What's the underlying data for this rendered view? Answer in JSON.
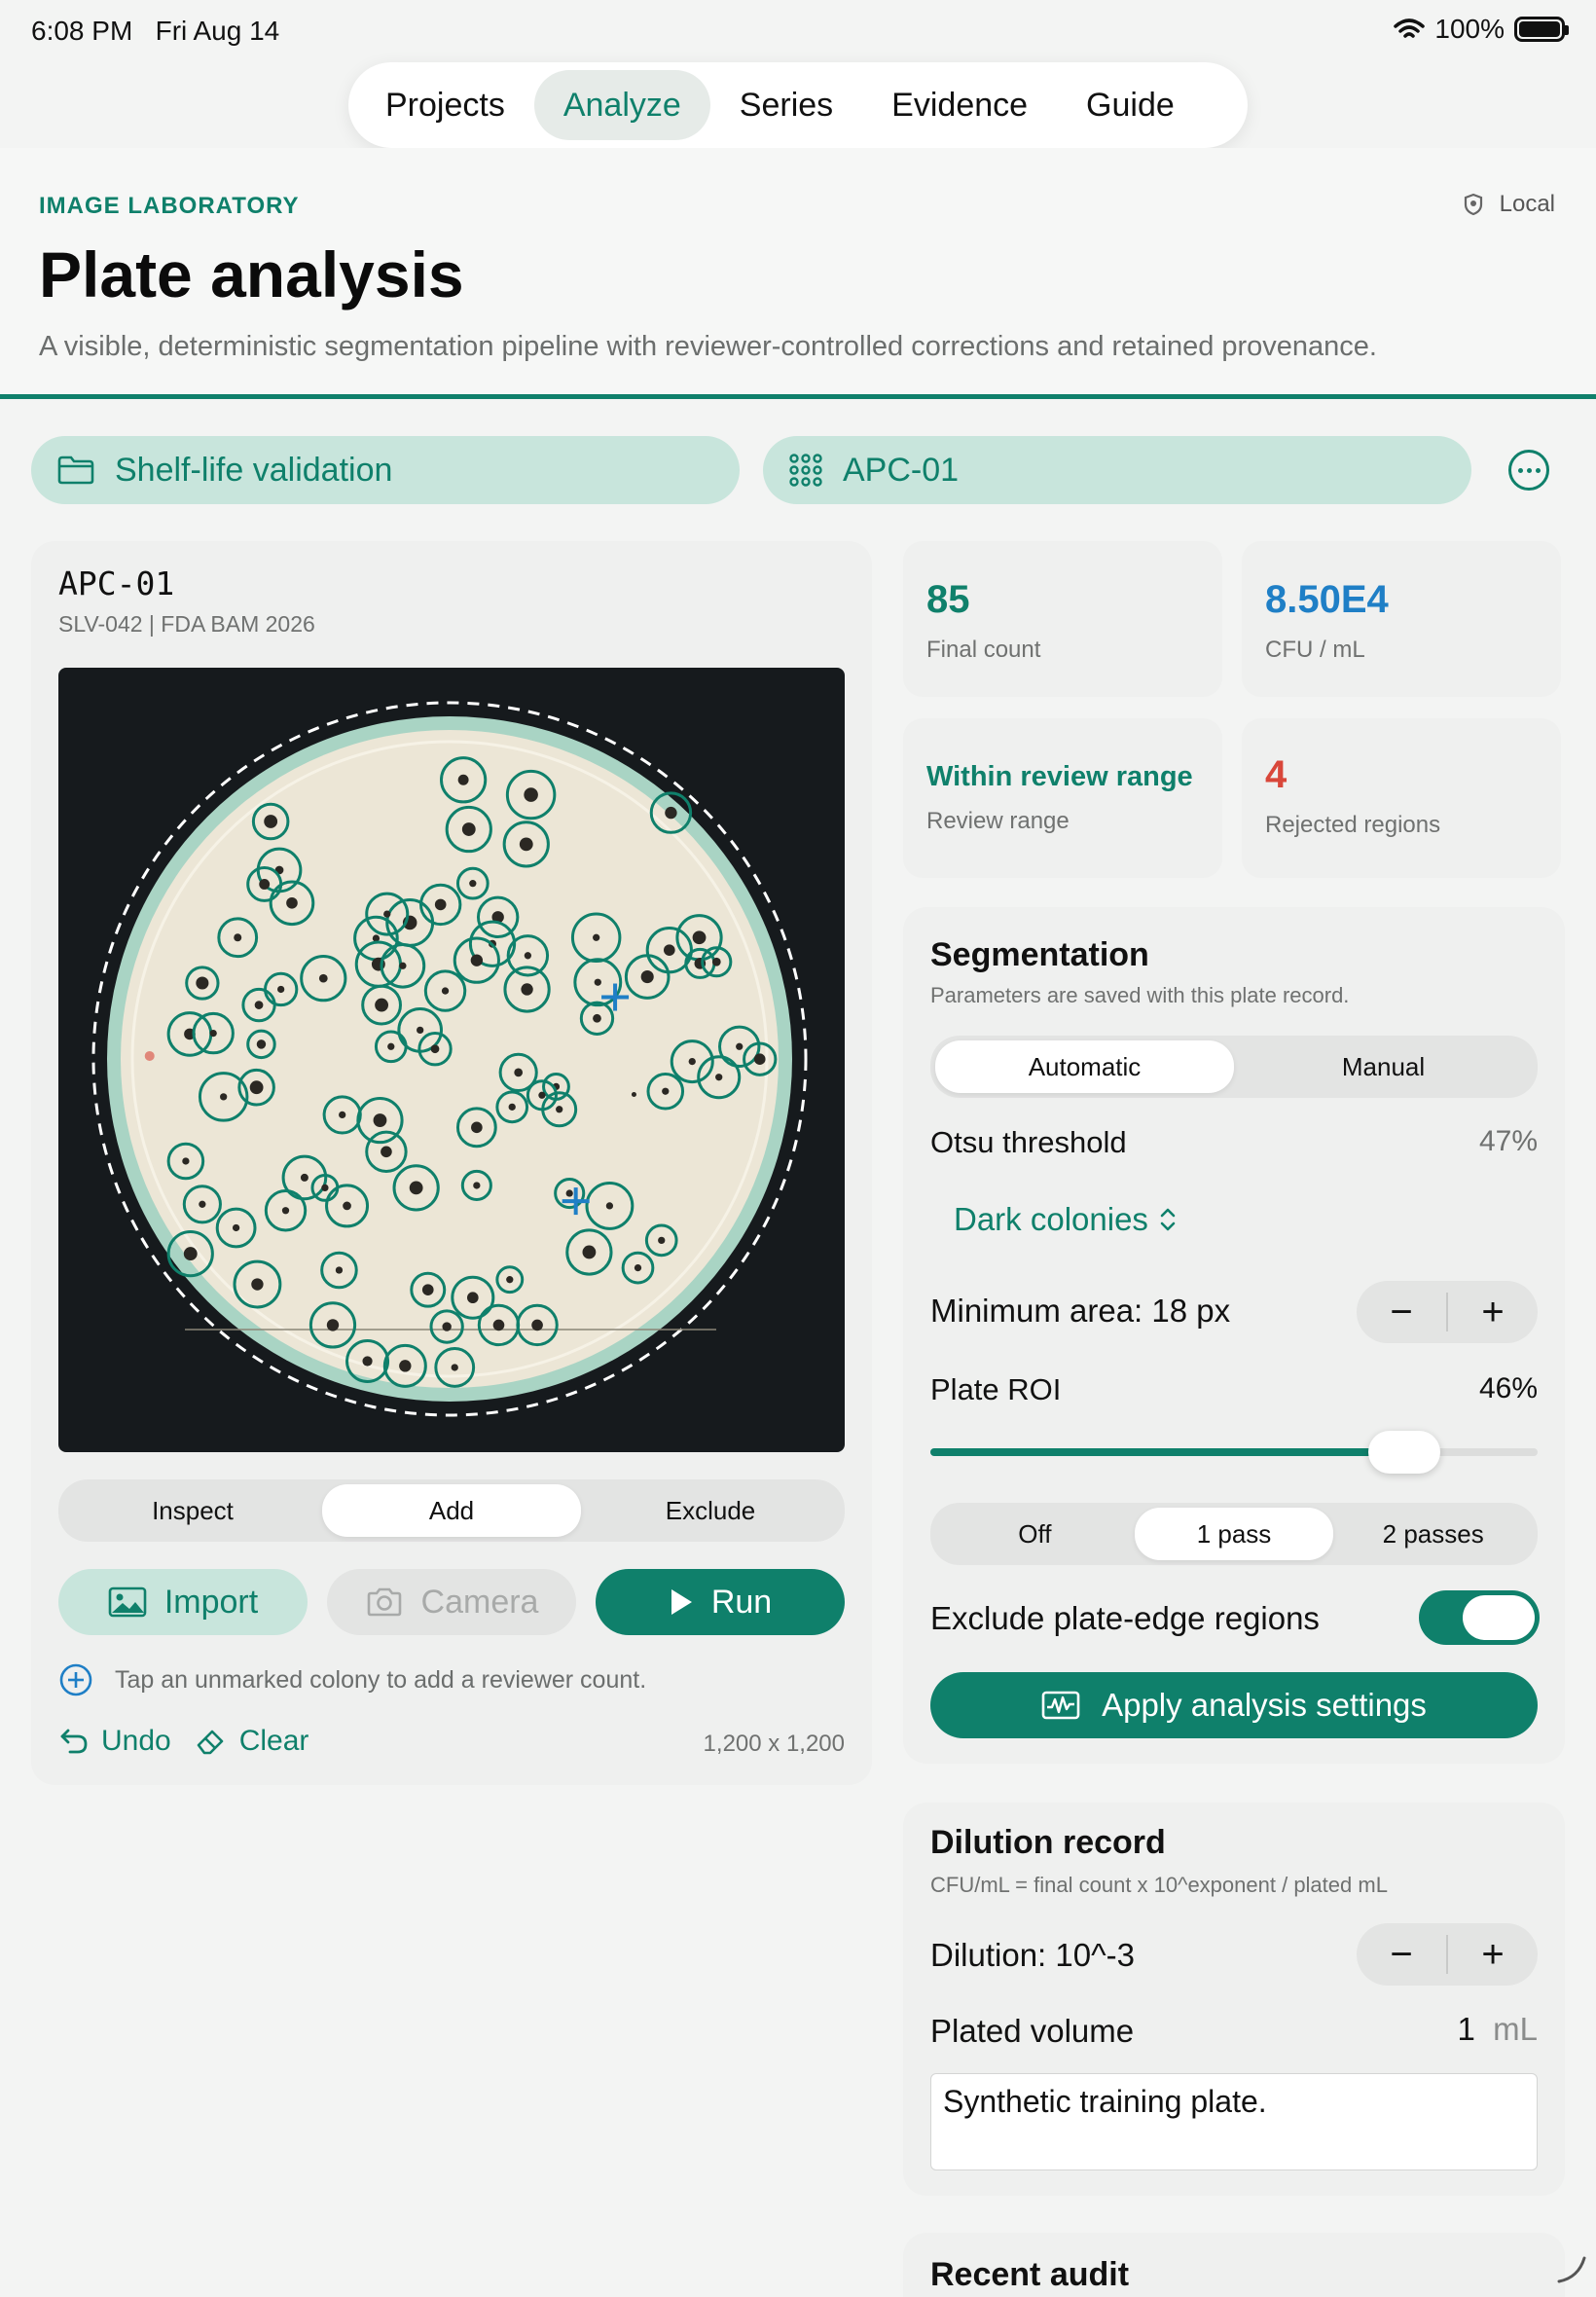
{
  "status": {
    "time": "6:08 PM",
    "date": "Fri Aug 14",
    "battery": "100%",
    "wifi_icon": "wifi-icon",
    "battery_icon": "battery-icon"
  },
  "topnav": {
    "tabs": [
      "Projects",
      "Analyze",
      "Series",
      "Evidence",
      "Guide"
    ],
    "active": "Analyze"
  },
  "header": {
    "eyebrow": "IMAGE LABORATORY",
    "badge": "Local",
    "title": "Plate analysis",
    "subtitle": "A visible, deterministic segmentation pipeline with reviewer-controlled corrections and retained provenance."
  },
  "selectors": {
    "project": "Shelf-life validation",
    "plate": "APC-01"
  },
  "plate": {
    "id": "APC-01",
    "meta": "SLV-042  |  FDA BAM 2026",
    "modes": [
      "Inspect",
      "Add",
      "Exclude"
    ],
    "active_mode": "Add",
    "import_label": "Import",
    "camera_label": "Camera",
    "run_label": "Run",
    "hint": "Tap an unmarked colony to add a reviewer count.",
    "undo_label": "Undo",
    "clear_label": "Clear",
    "dimensions": "1,200 x 1,200"
  },
  "metrics": {
    "final_count": "85",
    "final_count_label": "Final count",
    "cfu": "8.50E4",
    "cfu_label": "CFU / mL",
    "range_status": "Within review range",
    "range_label": "Review range",
    "rejected": "4",
    "rejected_label": "Rejected regions"
  },
  "segmentation": {
    "title": "Segmentation",
    "subtitle": "Parameters are saved with this plate record.",
    "modes": [
      "Automatic",
      "Manual"
    ],
    "active_mode": "Automatic",
    "otsu_label": "Otsu threshold",
    "otsu_value": "47%",
    "polarity": "Dark colonies",
    "min_area": "Minimum area: 18 px",
    "roi_label": "Plate ROI",
    "roi_value": "46%",
    "roi_fraction": 0.78,
    "passes": [
      "Off",
      "1 pass",
      "2 passes"
    ],
    "active_pass": "1 pass",
    "exclude_edge": "Exclude plate-edge regions",
    "exclude_edge_on": true,
    "apply": "Apply analysis settings"
  },
  "dilution": {
    "title": "Dilution record",
    "formula": "CFU/mL = final count x 10^exponent / plated mL",
    "dilution": "Dilution: 10^-3",
    "volume_label": "Plated volume",
    "volume_value": "1",
    "volume_unit": "mL",
    "notes": "Synthetic training plate."
  },
  "audit": {
    "title": "Recent audit"
  },
  "colors": {
    "accent": "#0f806b",
    "blue": "#1f7fc6",
    "red": "#d9473a",
    "agar": "#ece6d6"
  },
  "colonies": [
    [
      0.515,
      0.143,
      0.015,
      0.028
    ],
    [
      0.601,
      0.162,
      0.02,
      0.03
    ],
    [
      0.522,
      0.206,
      0.019,
      0.028
    ],
    [
      0.595,
      0.225,
      0.019,
      0.028
    ],
    [
      0.779,
      0.185,
      0.017,
      0.025
    ],
    [
      0.27,
      0.196,
      0.019,
      0.022
    ],
    [
      0.281,
      0.258,
      0.012,
      0.027
    ],
    [
      0.262,
      0.276,
      0.015,
      0.021
    ],
    [
      0.297,
      0.3,
      0.016,
      0.027
    ],
    [
      0.527,
      0.275,
      0.01,
      0.019
    ],
    [
      0.486,
      0.302,
      0.016,
      0.025
    ],
    [
      0.559,
      0.318,
      0.017,
      0.025
    ],
    [
      0.447,
      0.325,
      0.02,
      0.029
    ],
    [
      0.418,
      0.314,
      0.01,
      0.026
    ],
    [
      0.404,
      0.345,
      0.01,
      0.027
    ],
    [
      0.228,
      0.344,
      0.011,
      0.024
    ],
    [
      0.684,
      0.344,
      0.01,
      0.03
    ],
    [
      0.552,
      0.352,
      0.011,
      0.028
    ],
    [
      0.407,
      0.378,
      0.019,
      0.028
    ],
    [
      0.438,
      0.38,
      0.01,
      0.027
    ],
    [
      0.532,
      0.373,
      0.017,
      0.028
    ],
    [
      0.597,
      0.367,
      0.01,
      0.025
    ],
    [
      0.815,
      0.344,
      0.019,
      0.028
    ],
    [
      0.777,
      0.36,
      0.016,
      0.028
    ],
    [
      0.183,
      0.402,
      0.018,
      0.02
    ],
    [
      0.337,
      0.396,
      0.012,
      0.028
    ],
    [
      0.283,
      0.41,
      0.01,
      0.02
    ],
    [
      0.255,
      0.43,
      0.012,
      0.02
    ],
    [
      0.411,
      0.43,
      0.019,
      0.024
    ],
    [
      0.492,
      0.412,
      0.01,
      0.025
    ],
    [
      0.596,
      0.41,
      0.017,
      0.028
    ],
    [
      0.686,
      0.401,
      0.01,
      0.029
    ],
    [
      0.749,
      0.394,
      0.018,
      0.027
    ],
    [
      0.816,
      0.377,
      0.016,
      0.018
    ],
    [
      0.837,
      0.375,
      0.012,
      0.018
    ],
    [
      0.167,
      0.467,
      0.016,
      0.027
    ],
    [
      0.197,
      0.466,
      0.01,
      0.025
    ],
    [
      0.258,
      0.48,
      0.013,
      0.017
    ],
    [
      0.46,
      0.462,
      0.01,
      0.027
    ],
    [
      0.423,
      0.483,
      0.01,
      0.019
    ],
    [
      0.479,
      0.486,
      0.012,
      0.02
    ],
    [
      0.685,
      0.447,
      0.012,
      0.02
    ],
    [
      0.866,
      0.483,
      0.01,
      0.025
    ],
    [
      0.806,
      0.502,
      0.01,
      0.026
    ],
    [
      0.892,
      0.499,
      0.016,
      0.02
    ],
    [
      0.84,
      0.522,
      0.01,
      0.026
    ],
    [
      0.21,
      0.547,
      0.01,
      0.03
    ],
    [
      0.252,
      0.535,
      0.019,
      0.022
    ],
    [
      0.585,
      0.516,
      0.012,
      0.023
    ],
    [
      0.633,
      0.534,
      0.01,
      0.016
    ],
    [
      0.577,
      0.56,
      0.01,
      0.019
    ],
    [
      0.772,
      0.54,
      0.01,
      0.022
    ],
    [
      0.361,
      0.57,
      0.01,
      0.023
    ],
    [
      0.409,
      0.577,
      0.019,
      0.028
    ],
    [
      0.637,
      0.563,
      0.01,
      0.021
    ],
    [
      0.532,
      0.586,
      0.016,
      0.024
    ],
    [
      0.417,
      0.617,
      0.016,
      0.025
    ],
    [
      0.162,
      0.629,
      0.01,
      0.022
    ],
    [
      0.313,
      0.65,
      0.011,
      0.027
    ],
    [
      0.339,
      0.663,
      0.01,
      0.016
    ],
    [
      0.183,
      0.684,
      0.01,
      0.023
    ],
    [
      0.289,
      0.692,
      0.01,
      0.025
    ],
    [
      0.367,
      0.686,
      0.012,
      0.026
    ],
    [
      0.455,
      0.663,
      0.019,
      0.028
    ],
    [
      0.65,
      0.67,
      0.01,
      0.018
    ],
    [
      0.701,
      0.686,
      0.01,
      0.029
    ],
    [
      0.226,
      0.714,
      0.01,
      0.024
    ],
    [
      0.168,
      0.747,
      0.019,
      0.028
    ],
    [
      0.357,
      0.768,
      0.01,
      0.022
    ],
    [
      0.675,
      0.745,
      0.019,
      0.028
    ],
    [
      0.737,
      0.765,
      0.01,
      0.019
    ],
    [
      0.767,
      0.73,
      0.01,
      0.019
    ],
    [
      0.253,
      0.786,
      0.017,
      0.029
    ],
    [
      0.47,
      0.793,
      0.016,
      0.021
    ],
    [
      0.527,
      0.803,
      0.016,
      0.026
    ],
    [
      0.574,
      0.78,
      0.01,
      0.016
    ],
    [
      0.349,
      0.838,
      0.017,
      0.028
    ],
    [
      0.494,
      0.84,
      0.013,
      0.02
    ],
    [
      0.56,
      0.838,
      0.016,
      0.025
    ],
    [
      0.609,
      0.838,
      0.016,
      0.025
    ],
    [
      0.393,
      0.884,
      0.014,
      0.026
    ],
    [
      0.441,
      0.89,
      0.017,
      0.026
    ],
    [
      0.504,
      0.892,
      0.01,
      0.024
    ],
    [
      0.615,
      0.545,
      0.01,
      0.018
    ],
    [
      0.532,
      0.66,
      0.01,
      0.018
    ]
  ],
  "rejected_marks": [
    [
      0.116,
      0.495
    ]
  ],
  "added_marks": [
    [
      0.708,
      0.42
    ],
    [
      0.658,
      0.68
    ]
  ],
  "dark_specks": [
    [
      0.732,
      0.544
    ]
  ]
}
